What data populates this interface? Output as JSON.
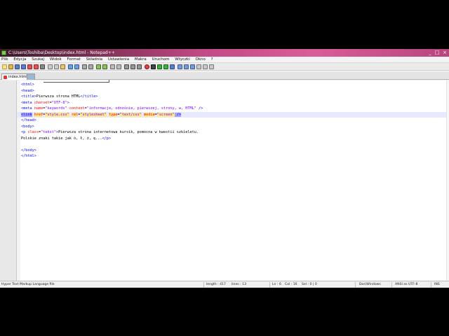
{
  "window": {
    "title": "C:\\Users\\Toshiba\\Desktop\\index.html - Notepad++"
  },
  "menu": [
    "Plik",
    "Edycja",
    "Szukaj",
    "Widok",
    "Format",
    "Składnia",
    "Ustawienia",
    "Makra",
    "Uruchom",
    "Wtyczki",
    "Okno",
    "?"
  ],
  "tabs": [
    {
      "label": "index.html",
      "active": true
    },
    {
      "label": "",
      "active": false
    }
  ],
  "code_lines": [
    "<html>",
    "<head>",
    "<title>Pierwsza strona HTML</title>",
    "<meta charset=\"UTF-8\">",
    "<meta name=\"keywords\" content=\"informacje, odnośnie, pierwszej, strony, w, HTML\" />",
    "<link href=\"style.css\" rel=\"stylesheet\" type=\"text/css\" media=\"screen\" />",
    "</head>",
    "<body>",
    "<p class=\"tekst\">Pierwsza strona internetowa kursik, pomocna w kwestii szkieletu.",
    "Polskie znaki takie jak ó, ł, ż, ę...</p>",
    "",
    "</body>",
    "</html>"
  ],
  "status": {
    "file_type": "Hyper Text Markup Language file",
    "length": "length : 417",
    "lines": "lines : 13",
    "position": "Ln : 6",
    "column": "Col : 16",
    "selection": "Sel : 0 | 0",
    "eol": "Dos\\Windows",
    "encoding": "ANSI as UTF-8",
    "mode": "INS"
  },
  "colors": {
    "title_bar": "#c24a86",
    "tag": "#0000ff",
    "attribute": "#ff0000",
    "value": "#8000ff",
    "current_line": "#e8e8ff"
  }
}
